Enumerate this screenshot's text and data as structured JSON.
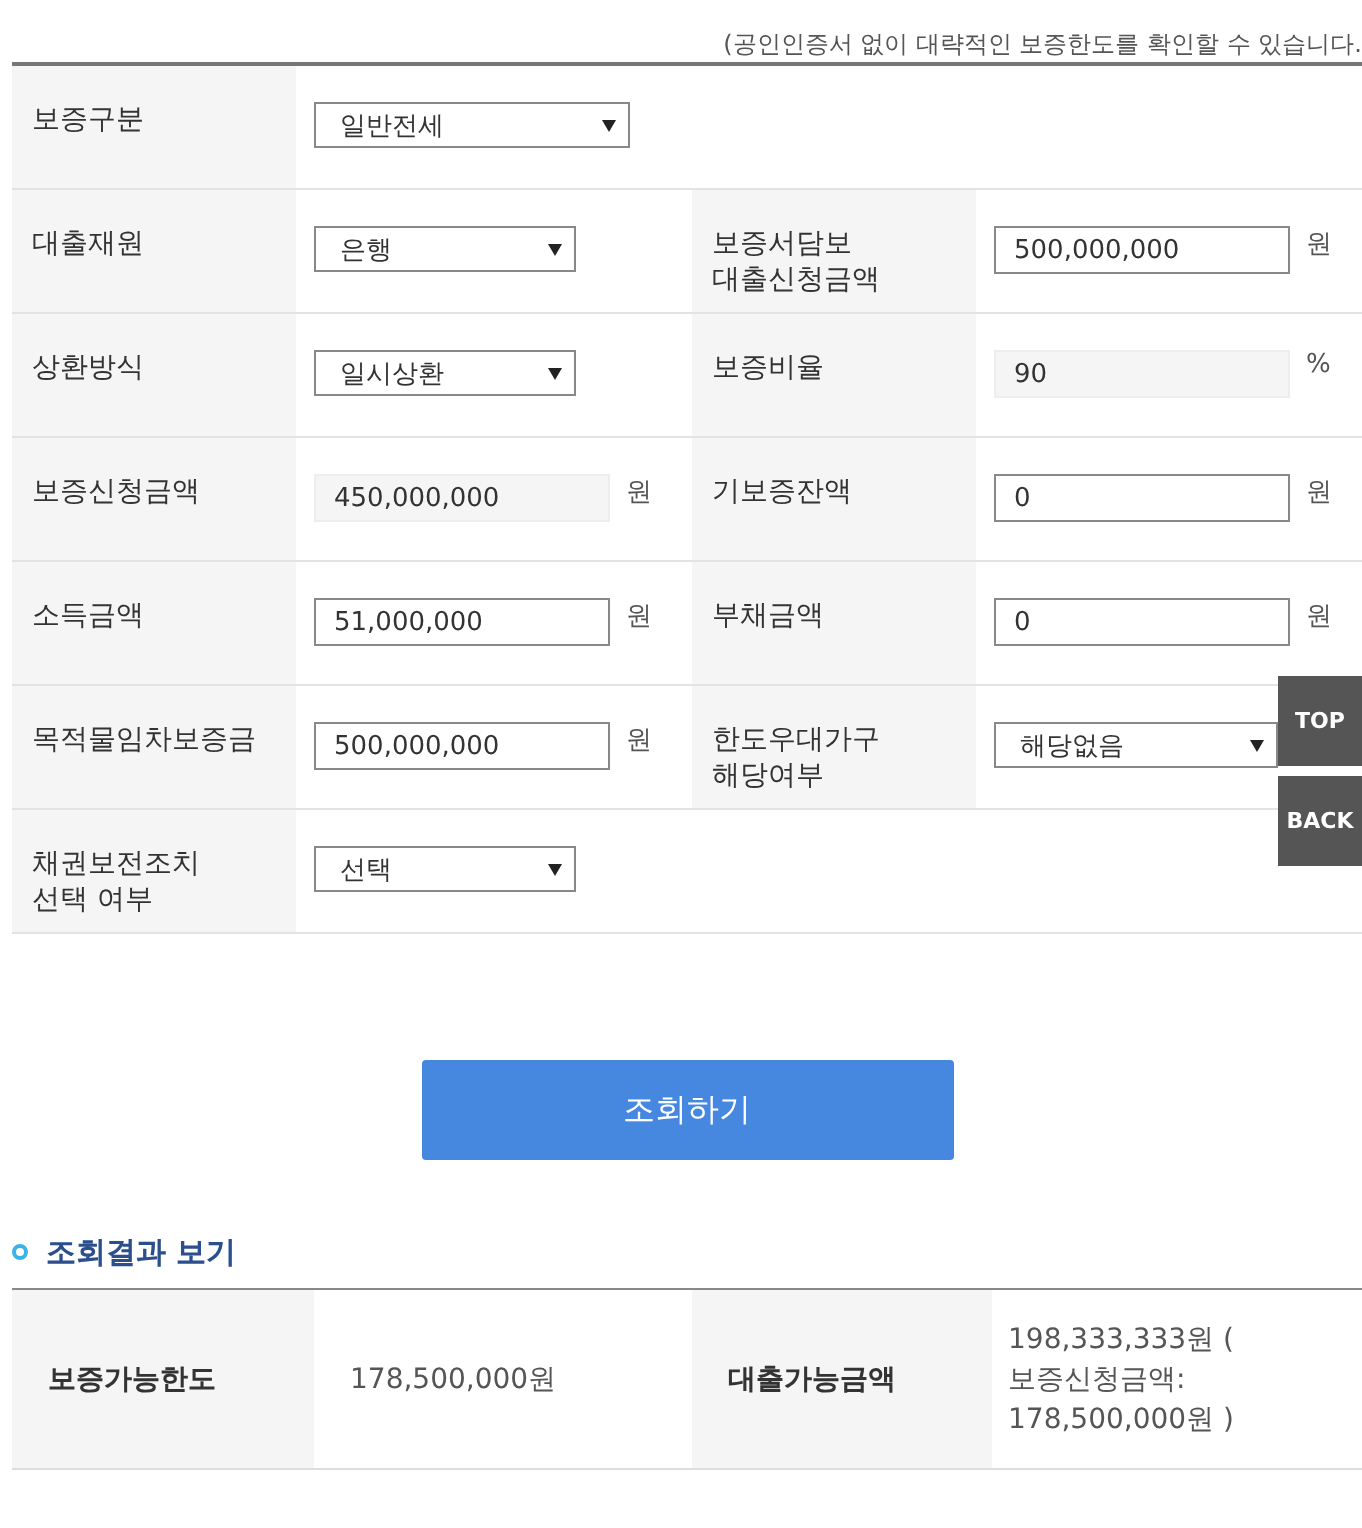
{
  "notice": "(공인인증서 없이 대략적인 보증한도를 확인할 수 있습니다.",
  "form_rows": [
    {
      "cells": [
        {
          "label": "보증구분",
          "field": {
            "kind": "select",
            "value": "일반전세",
            "wide": true
          }
        }
      ]
    },
    {
      "cells": [
        {
          "label": "대출재원",
          "field": {
            "kind": "select",
            "value": "은행",
            "wide": false
          }
        },
        {
          "label": "보증서담보\n대출신청금액",
          "field": {
            "kind": "input",
            "value": "500,000,000"
          },
          "unit": "원"
        }
      ]
    },
    {
      "cells": [
        {
          "label": "상환방식",
          "field": {
            "kind": "select",
            "value": "일시상환",
            "wide": false
          }
        },
        {
          "label": "보증비율",
          "field": {
            "kind": "readonly",
            "value": "90"
          },
          "unit": "%"
        }
      ]
    },
    {
      "cells": [
        {
          "label": "보증신청금액",
          "field": {
            "kind": "readonly",
            "value": "450,000,000"
          },
          "unit": "원"
        },
        {
          "label": "기보증잔액",
          "field": {
            "kind": "input",
            "value": "0"
          },
          "unit": "원"
        }
      ]
    },
    {
      "cells": [
        {
          "label": "소득금액",
          "field": {
            "kind": "input",
            "value": "51,000,000"
          },
          "unit": "원"
        },
        {
          "label": "부채금액",
          "field": {
            "kind": "input",
            "value": "0"
          },
          "unit": "원"
        }
      ]
    },
    {
      "cells": [
        {
          "label": "목적물임차보증금",
          "field": {
            "kind": "input",
            "value": "500,000,000"
          },
          "unit": "원"
        },
        {
          "label": "한도우대가구\n해당여부",
          "field": {
            "kind": "select",
            "value": "해당없음",
            "wide": true
          }
        }
      ]
    },
    {
      "cells": [
        {
          "label": "채권보전조치\n선택 여부",
          "field": {
            "kind": "select",
            "value": "선택",
            "wide": false
          }
        }
      ]
    }
  ],
  "submit_button": "조회하기",
  "result_title": "조회결과 보기",
  "result_rows": [
    {
      "cells": [
        {
          "label": "보증가능한도",
          "value": "178,500,000원"
        },
        {
          "label": "대출가능금액",
          "value": "198,333,333원 (\n보증신청금액:\n178,500,000원 )"
        }
      ]
    }
  ],
  "floating_buttons": [
    "TOP",
    "BACK"
  ]
}
